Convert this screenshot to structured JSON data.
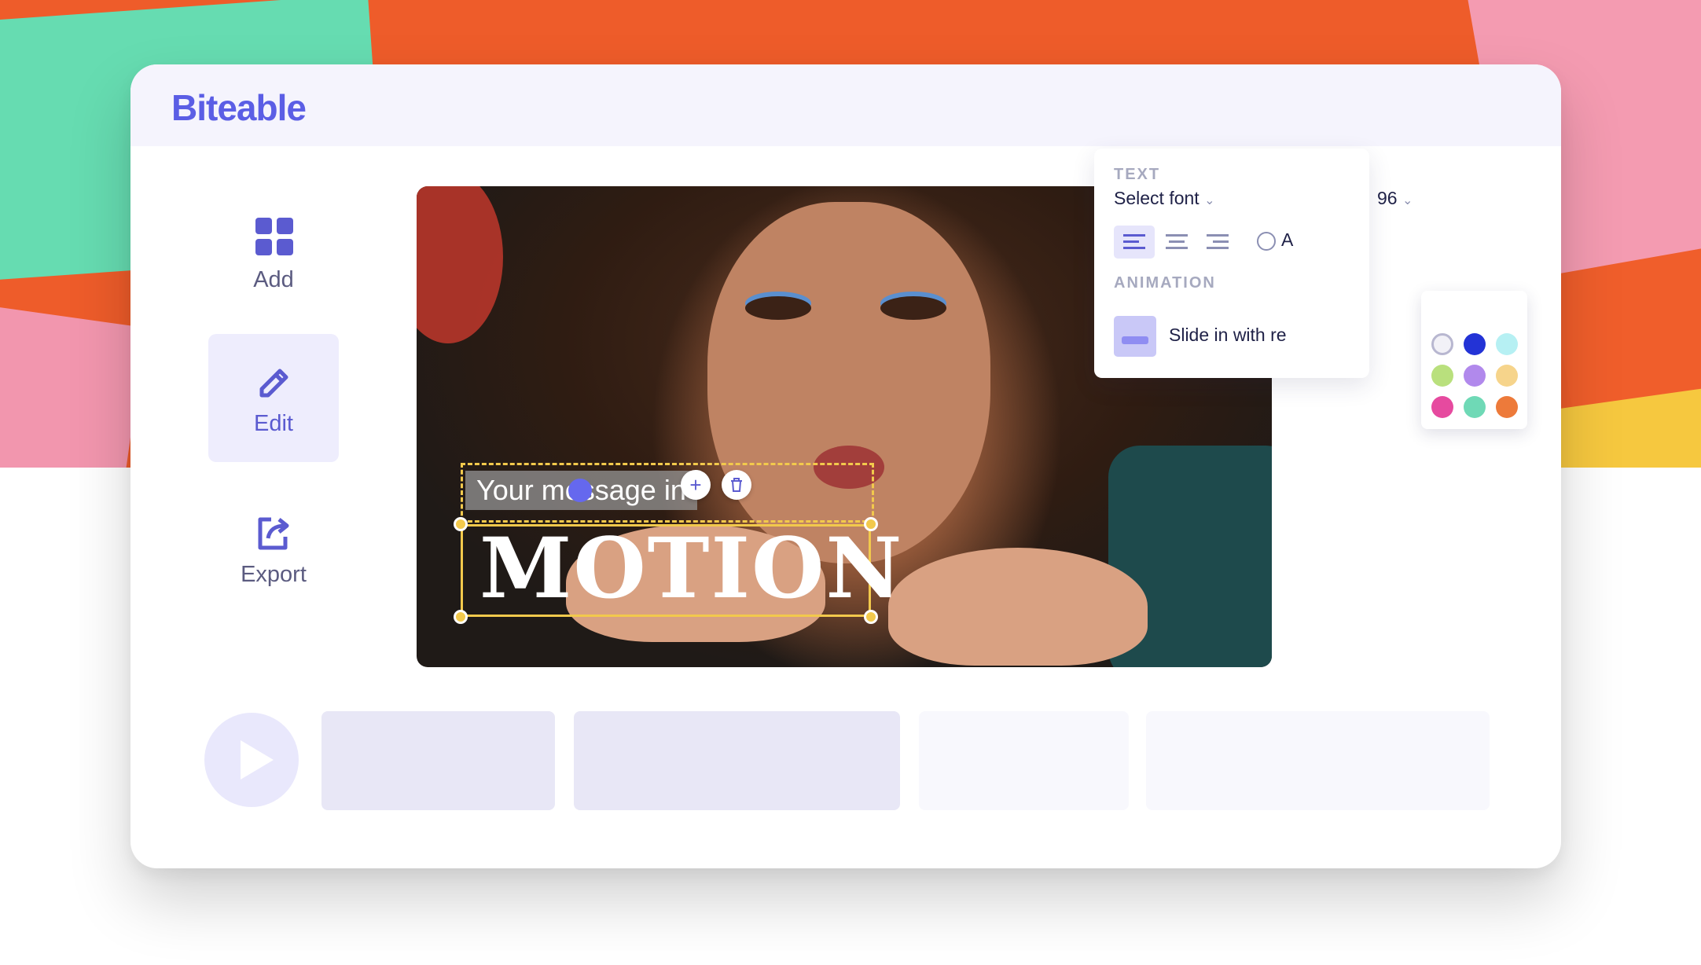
{
  "app": {
    "logo": "Biteable"
  },
  "sidebar": {
    "items": [
      {
        "label": "Add",
        "icon": "grid-icon"
      },
      {
        "label": "Edit",
        "icon": "pencil-icon",
        "active": true
      },
      {
        "label": "Export",
        "icon": "export-icon"
      }
    ]
  },
  "canvas": {
    "subtitle_text": "Your message in",
    "title_text": "MOTION",
    "add_icon": "plus-icon",
    "delete_icon": "trash-icon"
  },
  "text_panel": {
    "section_text": "TEXT",
    "font_select": "Select font",
    "font_size": "96",
    "color_label": "A",
    "alignments": [
      "align-left-icon",
      "align-center-icon",
      "align-right-icon"
    ],
    "section_animation": "ANIMATION",
    "animation_name": "Slide in with re"
  },
  "color_picker": {
    "current_color": "#111a5a",
    "eyedropper_icon": "eyedropper-icon",
    "swatches": [
      "#f2f1f7",
      "#2333d6",
      "#b6f0f3",
      "#b9e07d",
      "#b189ec",
      "#f6d48b",
      "#e64a9f",
      "#6fd9b6",
      "#ed7a3a"
    ]
  },
  "timeline": {
    "play_icon": "play-icon",
    "clip_colors": [
      "#e8e7f6",
      "#e8e7f6",
      "#f8f8fd",
      "#f8f8fd"
    ]
  },
  "colors": {
    "brand": "#5b5ee5",
    "accent_yellow": "#f2c94c"
  }
}
